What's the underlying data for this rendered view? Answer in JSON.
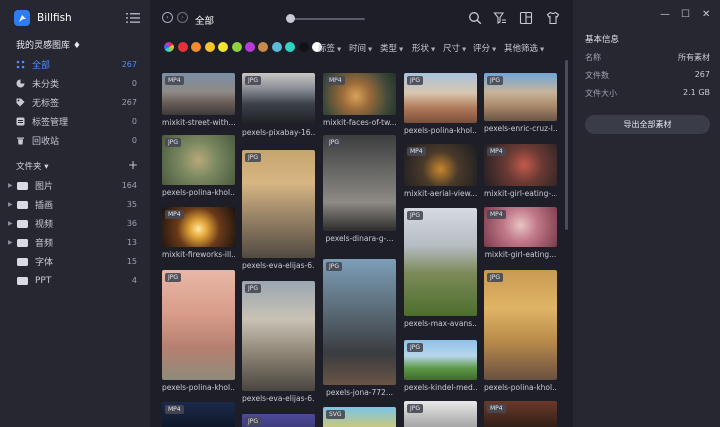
{
  "app": {
    "name": "Billfish"
  },
  "sidebar": {
    "library_title": "我的灵感图库 ♦",
    "items": [
      {
        "label": "全部",
        "count": "267",
        "icon": "grid-dots-icon",
        "active": true
      },
      {
        "label": "未分类",
        "count": "0",
        "icon": "pie-icon"
      },
      {
        "label": "无标签",
        "count": "267",
        "icon": "tag-icon"
      },
      {
        "label": "标签管理",
        "count": "0",
        "icon": "tag-manage-icon"
      },
      {
        "label": "回收站",
        "count": "0",
        "icon": "trash-icon"
      }
    ],
    "folders_label": "文件夹 ▾",
    "folders_add": "+",
    "folders": [
      {
        "label": "图片",
        "count": "164"
      },
      {
        "label": "插画",
        "count": "35"
      },
      {
        "label": "视频",
        "count": "36"
      },
      {
        "label": "音频",
        "count": "13"
      },
      {
        "label": "字体",
        "count": "15"
      },
      {
        "label": "PPT",
        "count": "4"
      }
    ]
  },
  "toolbar": {
    "breadcrumb": "全部",
    "icons": [
      "back-icon",
      "forward-icon",
      "search-icon",
      "filter-icon",
      "layout-icon",
      "shirt-icon"
    ]
  },
  "filters": {
    "colors": [
      "#e8323a",
      "#f58c2a",
      "#f7c431",
      "#f2e533",
      "#8fd13f",
      "#b73ad9",
      "#c98a4e",
      "#5eb8d6",
      "#2fd3c0",
      "#111216",
      "#ffffff"
    ],
    "labels": [
      "标签",
      "时间",
      "类型",
      "形状",
      "尺寸",
      "评分",
      "其他筛选"
    ]
  },
  "grid": {
    "tiles": [
      {
        "badge": "MP4",
        "caption": "mixkit-street-with..."
      },
      {
        "badge": "JPG",
        "caption": "pexels-pixabay-16..."
      },
      {
        "badge": "MP4",
        "caption": "mixkit-faces-of-tw..."
      },
      {
        "badge": "JPG",
        "caption": "pexels-polina-khol..."
      },
      {
        "badge": "JPG",
        "caption": "pexels-enric-cruz-l..."
      },
      {
        "badge": "JPG",
        "caption": "pexels-polina-khol..."
      },
      {
        "badge": "JPG",
        "caption": "pexels-eva-elijas-6..."
      },
      {
        "badge": "JPG",
        "caption": "pexels-dinara-g-..."
      },
      {
        "badge": "MP4",
        "caption": "mixkit-aerial-view..."
      },
      {
        "badge": "MP4",
        "caption": "mixkit-girl-eating-..."
      },
      {
        "badge": "MP4",
        "caption": "mixkit-fireworks-ill..."
      },
      {
        "badge": "JPG",
        "caption": "pexels-max-avans..."
      },
      {
        "badge": "MP4",
        "caption": "mixkit-girl-eating..."
      },
      {
        "badge": "JPG",
        "caption": "pexels-polina-khol..."
      },
      {
        "badge": "JPG",
        "caption": "pexels-eva-elijas-6..."
      },
      {
        "badge": "JPG",
        "caption": "pexels-jona-772..."
      },
      {
        "badge": "JPG",
        "caption": "pexels-kindel-med..."
      },
      {
        "badge": "JPG",
        "caption": "pexels-polina-khol..."
      },
      {
        "badge": "MP4",
        "caption": ""
      },
      {
        "badge": "JPG",
        "caption": ""
      },
      {
        "badge": "SVG",
        "caption": ""
      },
      {
        "badge": "JPG",
        "caption": ""
      },
      {
        "badge": "MP4",
        "caption": ""
      }
    ]
  },
  "panel": {
    "title": "基本信息",
    "rows": [
      {
        "label": "名称",
        "value": "所有素材"
      },
      {
        "label": "文件数",
        "value": "267"
      },
      {
        "label": "文件大小",
        "value": "2.1 GB"
      }
    ],
    "export_label": "导出全部素材"
  },
  "window_controls": [
    "—",
    "☐",
    "✕"
  ]
}
